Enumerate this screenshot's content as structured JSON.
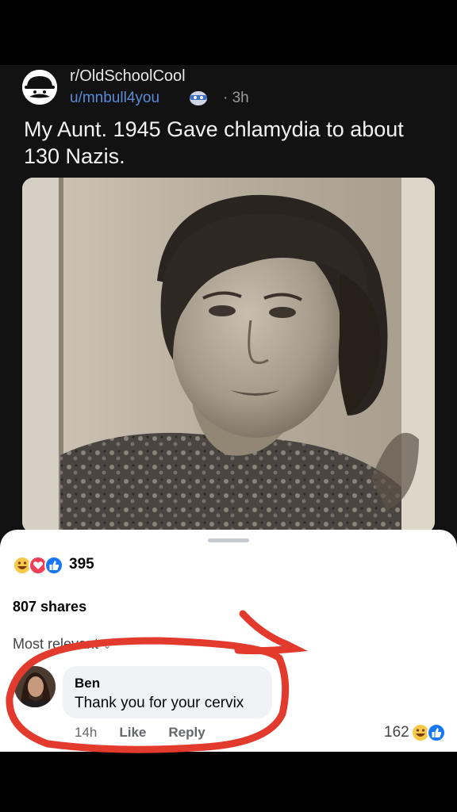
{
  "post": {
    "subreddit": "r/OldSchoolCool",
    "username": "u/mnbull4you",
    "age": "· 3h",
    "title": "My Aunt.  1945  Gave chlamydia to about 130 Nazis."
  },
  "facebook": {
    "reaction_count": "395",
    "shares": "807 shares",
    "sort_label": "Most relevant",
    "comment": {
      "author": "Ben",
      "text": "Thank you for your cervix",
      "time": "14h",
      "like_label": "Like",
      "reply_label": "Reply",
      "reaction_count": "162"
    }
  },
  "colors": {
    "annotation_red": "#e23b2d",
    "link_blue": "#5a8ad8",
    "like_blue": "#1877f2"
  }
}
